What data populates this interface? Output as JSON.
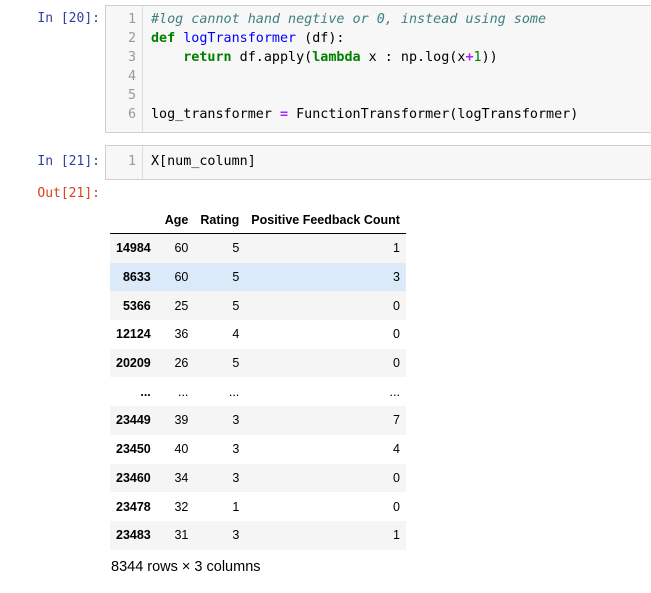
{
  "cells": [
    {
      "prompt": "In [20]:",
      "lines": [
        "1",
        "2",
        "3",
        "4",
        "5",
        "6"
      ]
    },
    {
      "prompt": "In [21]:",
      "lines": [
        "1"
      ],
      "code": "X[num_column]"
    }
  ],
  "code20": {
    "l1": "#log cannot hand negtive or 0, instead using some",
    "l2_kw": "def",
    "l2_fn": "logTransformer",
    "l2_rest": " (df):",
    "l3_indent": "    ",
    "l3_kw": "return",
    "l3_a": " df.apply(",
    "l3_kw2": "lambda",
    "l3_b": " x : np.log(x",
    "l3_op": "+",
    "l3_num": "1",
    "l3_c": "))",
    "l6_a": "log_transformer ",
    "l6_op": "=",
    "l6_b": " FunctionTransformer(logTransformer)"
  },
  "output": {
    "prompt": "Out[21]:",
    "columns": [
      "",
      "Age",
      "Rating",
      "Positive Feedback Count"
    ],
    "rows": [
      [
        "14984",
        "60",
        "5",
        "1"
      ],
      [
        "8633",
        "60",
        "5",
        "3"
      ],
      [
        "5366",
        "25",
        "5",
        "0"
      ],
      [
        "12124",
        "36",
        "4",
        "0"
      ],
      [
        "20209",
        "26",
        "5",
        "0"
      ],
      [
        "...",
        "...",
        "...",
        "..."
      ],
      [
        "23449",
        "39",
        "3",
        "7"
      ],
      [
        "23450",
        "40",
        "3",
        "4"
      ],
      [
        "23460",
        "34",
        "3",
        "0"
      ],
      [
        "23478",
        "32",
        "1",
        "0"
      ],
      [
        "23483",
        "31",
        "3",
        "1"
      ]
    ],
    "shape": "8344 rows × 3 columns"
  }
}
